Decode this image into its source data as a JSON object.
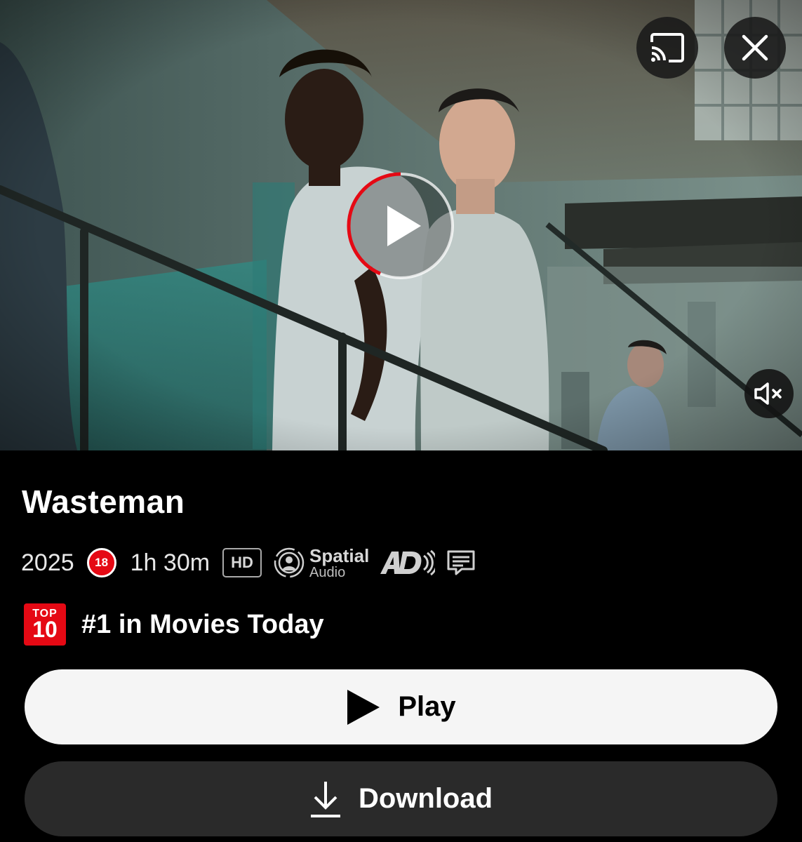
{
  "hero": {
    "cast_icon": "cast-icon",
    "close_icon": "close-icon",
    "play_icon": "play-circle-icon",
    "mute_icon": "muted-speaker-icon"
  },
  "details": {
    "title": "Wasteman",
    "year": "2025",
    "age_rating": "18",
    "duration": "1h 30m",
    "quality_badge": "HD",
    "spatial_audio": {
      "main": "Spatial",
      "sub": "Audio"
    },
    "audio_description_icon": "audio-description-icon",
    "subtitles_icon": "subtitles-icon"
  },
  "ranking": {
    "badge_top": "TOP",
    "badge_num": "10",
    "text": "#1 in Movies Today"
  },
  "actions": {
    "play_label": "Play",
    "download_label": "Download"
  },
  "colors": {
    "accent_red": "#e50914",
    "background": "#000000",
    "play_button_bg": "#f5f5f5",
    "download_button_bg": "#2a2a2a"
  }
}
